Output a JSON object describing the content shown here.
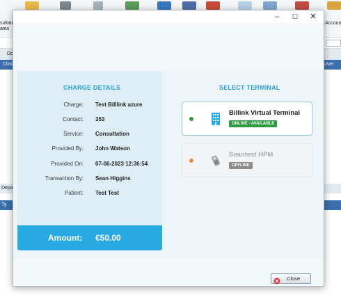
{
  "background_app": {
    "toolbar_labels": [
      "sultation",
      "ates",
      "Accoun"
    ],
    "row_do": "Do",
    "clinic_label": "Clini",
    "user_label": "User",
    "department_label": "Depa",
    "ty_label": "Ty"
  },
  "modal": {
    "window_controls": {
      "minimize": "–",
      "maximize": "☐",
      "close": "✕"
    },
    "charge_details": {
      "title": "CHARGE DETAILS",
      "rows": [
        {
          "label": "Charge:",
          "value": "Test Billlink azure"
        },
        {
          "label": "Contact:",
          "value": "353"
        },
        {
          "label": "Service:",
          "value": "Consultation"
        },
        {
          "label": "Provided By:",
          "value": "John Watson"
        },
        {
          "label": "Provided On:",
          "value": "07-06-2023 12:36:54"
        },
        {
          "label": "Transaction By:",
          "value": "Sean Higgins"
        },
        {
          "label": "Patient:",
          "value": "Test Test"
        }
      ],
      "amount_label": "Amount:",
      "amount_value": "€50.00"
    },
    "select_terminal": {
      "title": "SELECT TERMINAL",
      "terminals": [
        {
          "name": "Billink Virtual Terminal",
          "status": "ONLINE - AVAILABLE",
          "status_color": "#2e9b43",
          "icon": "building-icon"
        },
        {
          "name": "Seantest HPM",
          "status": "OFFLINE",
          "status_color": "#8c8c8c",
          "icon": "card-terminal-icon"
        }
      ]
    },
    "close_button": "Close"
  },
  "colors": {
    "accent": "#29a9e1",
    "online": "#2e9b43",
    "offline_dot": "#e98a3a"
  }
}
